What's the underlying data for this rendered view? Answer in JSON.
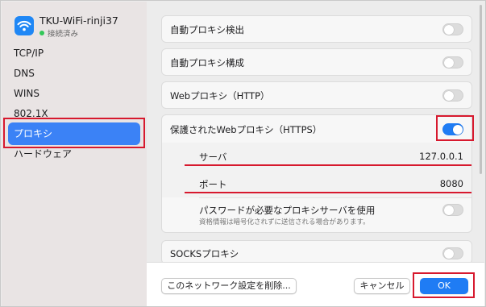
{
  "network": {
    "name": "TKU-WiFi-rinji37",
    "status": "接続済み",
    "icon": "wifi-icon"
  },
  "sidebar": {
    "items": [
      {
        "label": "TCP/IP",
        "selected": false
      },
      {
        "label": "DNS",
        "selected": false
      },
      {
        "label": "WINS",
        "selected": false
      },
      {
        "label": "802.1X",
        "selected": false
      },
      {
        "label": "プロキシ",
        "selected": true
      },
      {
        "label": "ハードウェア",
        "selected": false
      }
    ]
  },
  "proxies": {
    "auto_detect": {
      "label": "自動プロキシ検出",
      "enabled": false
    },
    "auto_config": {
      "label": "自動プロキシ構成",
      "enabled": false
    },
    "http": {
      "label": "Webプロキシ（HTTP）",
      "enabled": false
    },
    "https": {
      "label": "保護されたWebプロキシ（HTTPS）",
      "enabled": true,
      "server_label": "サーバ",
      "server_value": "127.0.0.1",
      "port_label": "ポート",
      "port_value": "8080",
      "auth_label": "パスワードが必要なプロキシサーバを使用",
      "auth_note": "資格情報は暗号化されずに送信される場合があります。",
      "auth_enabled": false
    },
    "socks": {
      "label": "SOCKSプロキシ",
      "enabled": false
    }
  },
  "footer": {
    "delete_label": "このネットワーク設定を削除...",
    "cancel_label": "キャンセル",
    "ok_label": "OK"
  },
  "colors": {
    "accent": "#1f7cf4",
    "highlight": "#d7192e",
    "sidebar_bg": "#e9e4e4",
    "status_green": "#34c759"
  }
}
